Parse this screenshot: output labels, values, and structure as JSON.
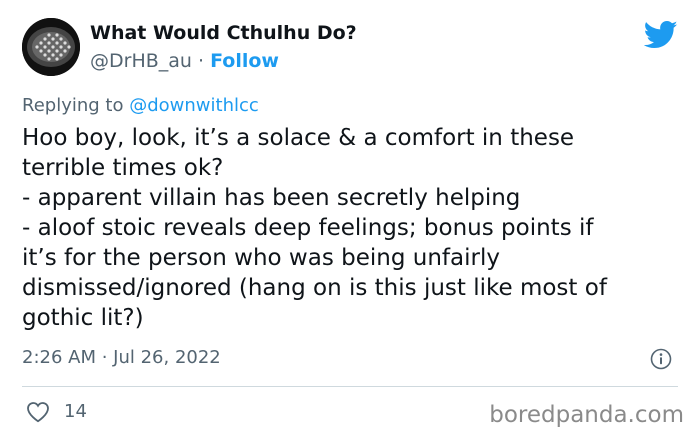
{
  "tweet": {
    "author_name": "What Would Cthulhu Do?",
    "handle": "@DrHB_au",
    "separator": "·",
    "follow_label": "Follow",
    "replying_prefix": "Replying to",
    "replying_mention": "@downwithlcc",
    "body_lines": [
      "Hoo boy, look, it’s a solace & a comfort in these",
      "terrible times ok?",
      "- apparent villain has been secretly helping",
      "- aloof stoic reveals deep feelings; bonus points if",
      "it’s for the person who was being unfairly",
      "dismissed/ignored (hang on is this just like most of",
      "gothic lit?)"
    ],
    "timestamp": "2:26 AM · Jul 26, 2022",
    "like_count": "14"
  },
  "watermark": "boredpanda.com",
  "icons": {
    "brand": "twitter-bird-icon",
    "info": "info-icon",
    "like": "heart-icon"
  },
  "colors": {
    "accent": "#1d9bf0",
    "secondary_text": "#536471",
    "primary_text": "#0f1419"
  }
}
